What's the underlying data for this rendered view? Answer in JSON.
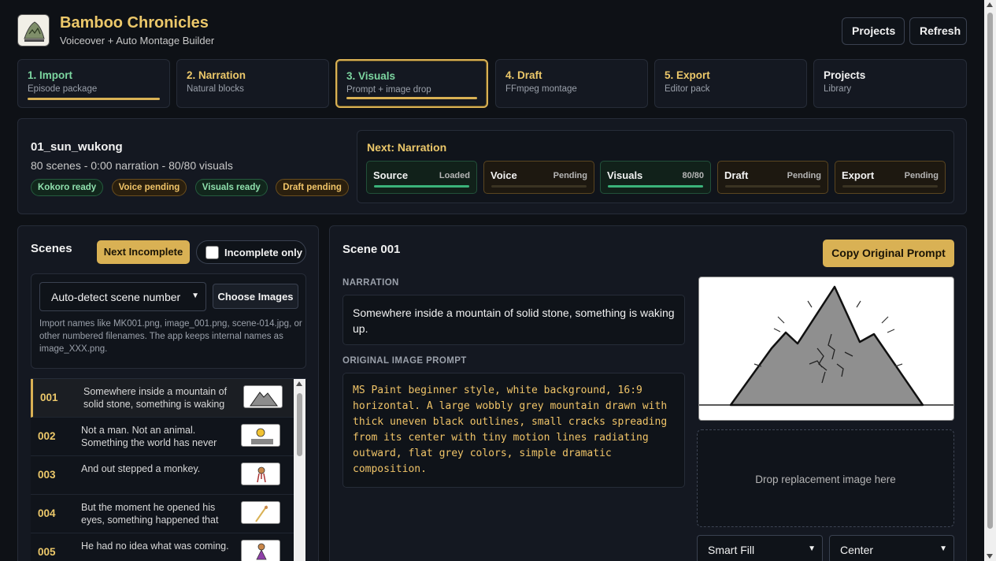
{
  "header": {
    "title": "Bamboo Chronicles",
    "subtitle": "Voiceover + Auto Montage Builder",
    "projects_label": "Projects",
    "refresh_label": "Refresh"
  },
  "steps": [
    {
      "title": "1. Import",
      "sub": "Episode package"
    },
    {
      "title": "2. Narration",
      "sub": "Natural blocks"
    },
    {
      "title": "3. Visuals",
      "sub": "Prompt + image drop"
    },
    {
      "title": "4. Draft",
      "sub": "FFmpeg montage"
    },
    {
      "title": "5. Export",
      "sub": "Editor pack"
    },
    {
      "title": "Projects",
      "sub": "Library"
    }
  ],
  "episode": {
    "title": "01_sun_wukong",
    "meta": "80 scenes - 0:00 narration - 80/80 visuals",
    "chips": [
      "Kokoro ready",
      "Voice pending",
      "Visuals ready",
      "Draft pending"
    ]
  },
  "next": {
    "title": "Next: Narration",
    "stages": [
      {
        "name": "Source",
        "value": "Loaded",
        "progress": 1.0
      },
      {
        "name": "Voice",
        "value": "Pending",
        "progress": 0
      },
      {
        "name": "Visuals",
        "value": "80/80",
        "progress": 1.0
      },
      {
        "name": "Draft",
        "value": "Pending",
        "progress": 0
      },
      {
        "name": "Export",
        "value": "Pending",
        "progress": 0
      }
    ]
  },
  "scenes": {
    "title": "Scenes",
    "next_incomplete_label": "Next Incomplete",
    "incomplete_only_label": "Incomplete only",
    "detect_select_value": "Auto-detect scene number",
    "choose_images_label": "Choose Images",
    "import_hint": "Import names like MK001.png, image_001.png, scene-014.jpg, or other numbered filenames. The app keeps internal names as image_XXX.png.",
    "items": [
      {
        "num": "001",
        "text": "Somewhere inside a mountain of solid stone, something is waking"
      },
      {
        "num": "002",
        "text": "Not a man. Not an animal. Something the world has never"
      },
      {
        "num": "003",
        "text": "And out stepped a monkey."
      },
      {
        "num": "004",
        "text": "But the moment he opened his eyes, something happened that"
      },
      {
        "num": "005",
        "text": "He had no idea what was coming."
      }
    ]
  },
  "detail": {
    "title": "Scene 001",
    "copy_label": "Copy Original Prompt",
    "narration_label": "NARRATION",
    "narration": "Somewhere inside a mountain of solid stone, something is waking up.",
    "prompt_label": "ORIGINAL IMAGE PROMPT",
    "prompt": "MS Paint beginner style, white background, 16:9 horizontal. A large wobbly grey mountain drawn with thick uneven black outlines, small cracks spreading from its center with tiny motion lines radiating outward, flat grey colors, simple dramatic composition.",
    "drop_label": "Drop replacement image here",
    "fit_value": "Smart Fill",
    "anchor_value": "Center"
  },
  "colors": {
    "accent": "#d9b154",
    "ok": "#7cd6a0",
    "bg": "#0e1116"
  }
}
